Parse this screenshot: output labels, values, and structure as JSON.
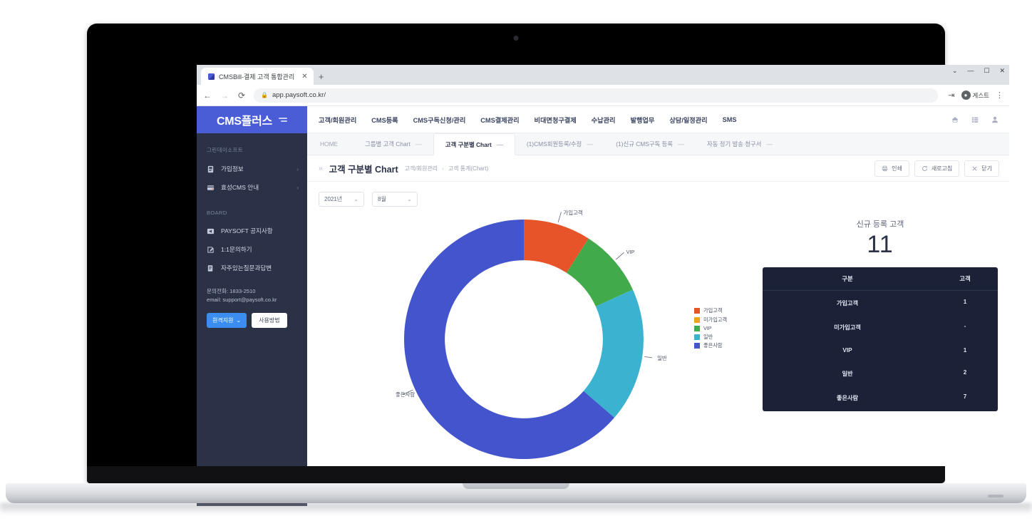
{
  "browser": {
    "tab_title": "CMSBill-결제 고객 통합관리",
    "tab_close": "✕",
    "new_tab": "+",
    "back": "←",
    "forward": "→",
    "reload": "⟳",
    "lock_icon": "🔒",
    "url": "app.paysoft.co.kr/",
    "profile_label": "게스트",
    "profile_initial": "●",
    "share_icon": "⇥",
    "menu_icon": "⋮",
    "win_minimize": "—",
    "win_maximize": "☐",
    "win_close": "✕",
    "win_chevron": "⌄"
  },
  "sidebar": {
    "logo": "CMS플러스",
    "company": "그린데이소프트",
    "items": [
      {
        "label": "가입정보",
        "icon": "id-card-icon",
        "chevron": "›"
      },
      {
        "label": "효성CMS 안내",
        "icon": "card-icon",
        "chevron": "›"
      }
    ],
    "board_section": "BOARD",
    "board_items": [
      {
        "label": "PAYSOFT 공지사항",
        "icon": "megaphone-icon"
      },
      {
        "label": "1:1문의하기",
        "icon": "pencil-note-icon"
      },
      {
        "label": "자주있는질문과답변",
        "icon": "document-icon"
      }
    ],
    "contact_phone": "문의전화: 1833-2510",
    "contact_email": "email: support@paysoft.co.kr",
    "remote_button": "원격지원",
    "remote_caret": "⌄",
    "howto_button": "사용방법"
  },
  "topnav": {
    "items": [
      "고객/회원관리",
      "CMS등록",
      "CMS구독신청/관리",
      "CMS결제관리",
      "비대면청구결제",
      "수납관리",
      "발행업무",
      "상담/일정관리",
      "SMS"
    ],
    "right_icons": [
      "home-icon",
      "grid-icon",
      "user-icon"
    ]
  },
  "tabbar": {
    "home": "HOME",
    "tabs": [
      {
        "label": "그룹별 고객 Chart",
        "close": "—",
        "active": false
      },
      {
        "label": "고객 구분별 Chart",
        "close": "—",
        "active": true
      },
      {
        "label": "(1)CMS회원등록/수정",
        "close": "—",
        "active": false
      },
      {
        "label": "(1)신규 CMS구독 등록",
        "close": "—",
        "active": false
      },
      {
        "label": "자동 정기 발송 청구서",
        "close": "—",
        "active": false
      }
    ]
  },
  "breadcrumb": {
    "chevron": "»",
    "title": "고객 구분별 Chart",
    "path": [
      "고객/회원관리",
      "고객 통계(Chart)"
    ],
    "separator": "›",
    "buttons": [
      {
        "label": "인쇄",
        "icon": "printer-icon"
      },
      {
        "label": "새로고침",
        "icon": "refresh-icon"
      },
      {
        "label": "닫기",
        "icon": "close-icon"
      }
    ]
  },
  "filters": [
    {
      "name": "year-select",
      "value": "2021년",
      "caret": "⌄"
    },
    {
      "name": "month-select",
      "value": "8월",
      "caret": "⌄"
    }
  ],
  "stats": {
    "title": "신규 등록 고객",
    "total": "11",
    "table": {
      "headers": [
        "구분",
        "고객"
      ],
      "rows": [
        {
          "label": "가입고객",
          "value": "1"
        },
        {
          "label": "미가입고객",
          "value": "-"
        },
        {
          "label": "VIP",
          "value": "1"
        },
        {
          "label": "일반",
          "value": "2"
        },
        {
          "label": "좋은사람",
          "value": "7"
        }
      ]
    }
  },
  "chart_data": {
    "type": "pie",
    "variant": "donut",
    "title": "고객 구분별 Chart",
    "categories": [
      "가입고객",
      "미가입고객",
      "VIP",
      "일반",
      "좋은사람"
    ],
    "values": [
      1,
      0,
      1,
      2,
      7
    ],
    "total": 11,
    "colors": [
      "#e8542a",
      "#efa31d",
      "#41ab4b",
      "#3bb3d0",
      "#4354cc"
    ],
    "legend": [
      {
        "label": "가입고객",
        "color": "#e8542a"
      },
      {
        "label": "미가입고객",
        "color": "#efa31d"
      },
      {
        "label": "VIP",
        "color": "#41ab4b"
      },
      {
        "label": "일반",
        "color": "#3bb3d0"
      },
      {
        "label": "좋은사람",
        "color": "#4354cc"
      }
    ],
    "legend_position": "right",
    "outside_labels": [
      "가입고객",
      "VIP",
      "일반",
      "좋은사람"
    ],
    "start_angle_deg": 0,
    "inner_radius_ratio": 0.66
  }
}
